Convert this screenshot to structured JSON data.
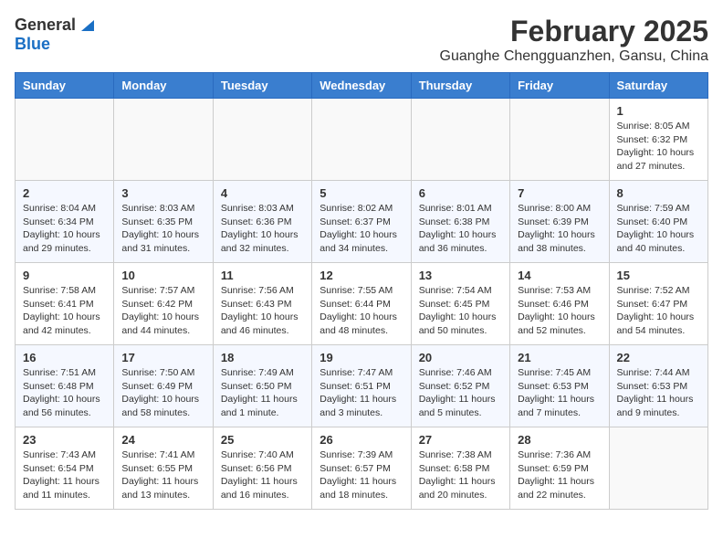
{
  "app": {
    "logo_general": "General",
    "logo_blue": "Blue",
    "title": "February 2025",
    "subtitle": "Guanghe Chengguanzhen, Gansu, China"
  },
  "calendar": {
    "headers": [
      "Sunday",
      "Monday",
      "Tuesday",
      "Wednesday",
      "Thursday",
      "Friday",
      "Saturday"
    ],
    "weeks": [
      [
        {
          "day": "",
          "info": ""
        },
        {
          "day": "",
          "info": ""
        },
        {
          "day": "",
          "info": ""
        },
        {
          "day": "",
          "info": ""
        },
        {
          "day": "",
          "info": ""
        },
        {
          "day": "",
          "info": ""
        },
        {
          "day": "1",
          "info": "Sunrise: 8:05 AM\nSunset: 6:32 PM\nDaylight: 10 hours and 27 minutes."
        }
      ],
      [
        {
          "day": "2",
          "info": "Sunrise: 8:04 AM\nSunset: 6:34 PM\nDaylight: 10 hours and 29 minutes."
        },
        {
          "day": "3",
          "info": "Sunrise: 8:03 AM\nSunset: 6:35 PM\nDaylight: 10 hours and 31 minutes."
        },
        {
          "day": "4",
          "info": "Sunrise: 8:03 AM\nSunset: 6:36 PM\nDaylight: 10 hours and 32 minutes."
        },
        {
          "day": "5",
          "info": "Sunrise: 8:02 AM\nSunset: 6:37 PM\nDaylight: 10 hours and 34 minutes."
        },
        {
          "day": "6",
          "info": "Sunrise: 8:01 AM\nSunset: 6:38 PM\nDaylight: 10 hours and 36 minutes."
        },
        {
          "day": "7",
          "info": "Sunrise: 8:00 AM\nSunset: 6:39 PM\nDaylight: 10 hours and 38 minutes."
        },
        {
          "day": "8",
          "info": "Sunrise: 7:59 AM\nSunset: 6:40 PM\nDaylight: 10 hours and 40 minutes."
        }
      ],
      [
        {
          "day": "9",
          "info": "Sunrise: 7:58 AM\nSunset: 6:41 PM\nDaylight: 10 hours and 42 minutes."
        },
        {
          "day": "10",
          "info": "Sunrise: 7:57 AM\nSunset: 6:42 PM\nDaylight: 10 hours and 44 minutes."
        },
        {
          "day": "11",
          "info": "Sunrise: 7:56 AM\nSunset: 6:43 PM\nDaylight: 10 hours and 46 minutes."
        },
        {
          "day": "12",
          "info": "Sunrise: 7:55 AM\nSunset: 6:44 PM\nDaylight: 10 hours and 48 minutes."
        },
        {
          "day": "13",
          "info": "Sunrise: 7:54 AM\nSunset: 6:45 PM\nDaylight: 10 hours and 50 minutes."
        },
        {
          "day": "14",
          "info": "Sunrise: 7:53 AM\nSunset: 6:46 PM\nDaylight: 10 hours and 52 minutes."
        },
        {
          "day": "15",
          "info": "Sunrise: 7:52 AM\nSunset: 6:47 PM\nDaylight: 10 hours and 54 minutes."
        }
      ],
      [
        {
          "day": "16",
          "info": "Sunrise: 7:51 AM\nSunset: 6:48 PM\nDaylight: 10 hours and 56 minutes."
        },
        {
          "day": "17",
          "info": "Sunrise: 7:50 AM\nSunset: 6:49 PM\nDaylight: 10 hours and 58 minutes."
        },
        {
          "day": "18",
          "info": "Sunrise: 7:49 AM\nSunset: 6:50 PM\nDaylight: 11 hours and 1 minute."
        },
        {
          "day": "19",
          "info": "Sunrise: 7:47 AM\nSunset: 6:51 PM\nDaylight: 11 hours and 3 minutes."
        },
        {
          "day": "20",
          "info": "Sunrise: 7:46 AM\nSunset: 6:52 PM\nDaylight: 11 hours and 5 minutes."
        },
        {
          "day": "21",
          "info": "Sunrise: 7:45 AM\nSunset: 6:53 PM\nDaylight: 11 hours and 7 minutes."
        },
        {
          "day": "22",
          "info": "Sunrise: 7:44 AM\nSunset: 6:53 PM\nDaylight: 11 hours and 9 minutes."
        }
      ],
      [
        {
          "day": "23",
          "info": "Sunrise: 7:43 AM\nSunset: 6:54 PM\nDaylight: 11 hours and 11 minutes."
        },
        {
          "day": "24",
          "info": "Sunrise: 7:41 AM\nSunset: 6:55 PM\nDaylight: 11 hours and 13 minutes."
        },
        {
          "day": "25",
          "info": "Sunrise: 7:40 AM\nSunset: 6:56 PM\nDaylight: 11 hours and 16 minutes."
        },
        {
          "day": "26",
          "info": "Sunrise: 7:39 AM\nSunset: 6:57 PM\nDaylight: 11 hours and 18 minutes."
        },
        {
          "day": "27",
          "info": "Sunrise: 7:38 AM\nSunset: 6:58 PM\nDaylight: 11 hours and 20 minutes."
        },
        {
          "day": "28",
          "info": "Sunrise: 7:36 AM\nSunset: 6:59 PM\nDaylight: 11 hours and 22 minutes."
        },
        {
          "day": "",
          "info": ""
        }
      ]
    ]
  }
}
